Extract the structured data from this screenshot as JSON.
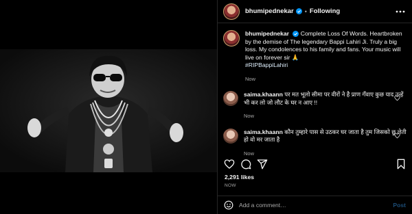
{
  "post": {
    "username": "bhumipednekar",
    "separator": "•",
    "follow_status": "Following",
    "caption": "Complete Loss Of Words. Heartbroken by the demise of The legendary Bappi Lahiri Ji. Truly a big loss. My condolences to his family and fans. Your music will live on forever sir 🙏",
    "hashtag": "#RIPBappiLahiri",
    "caption_time": "Now",
    "likes": "2,291 likes",
    "post_time": "NOW"
  },
  "comments": [
    {
      "username": "saima.khaann",
      "text": "पर मत भूलो सीमा पर वीरों ने है प्राण गँवाए कुछ याद उन्हें भी कर लो जो लौट के घर न आए !!",
      "time": "Now"
    },
    {
      "username": "saima.khaann",
      "text": "कौन तुम्हारे पास से उठकर घर जाता है तुम जिसको छू लेती हो वो मर जाता है",
      "time": "Now"
    }
  ],
  "composer": {
    "placeholder": "Add a comment…",
    "post_label": "Post"
  },
  "icons": [
    "verified-icon",
    "more-options-icon",
    "heart-icon",
    "comment-icon",
    "share-icon",
    "save-icon",
    "emoji-icon"
  ],
  "colors": {
    "background": "#000000",
    "text": "#f5f5f5",
    "muted": "#a8a8a8",
    "verified": "#0095f6",
    "post_disabled": "#1c4d77"
  }
}
